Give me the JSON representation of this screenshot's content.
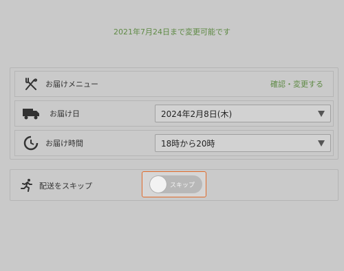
{
  "deadline_notice": "2021年7月24日まで変更可能です",
  "menu_row": {
    "label": "お届けメニュー",
    "link": "確認・変更する",
    "icon": "fork-knife-icon"
  },
  "date_row": {
    "label": "お届け日",
    "value": "2024年2月8日(木)",
    "icon": "truck-icon"
  },
  "time_row": {
    "label": "お届け時間",
    "value": "18時から20時",
    "icon": "clock-icon"
  },
  "skip_row": {
    "label": "配送をスキップ",
    "toggle_text": "スキップ",
    "toggle_on": false,
    "icon": "running-person-icon"
  },
  "colors": {
    "accent_green": "#5f8a45",
    "focus_orange": "#e06a2a"
  }
}
